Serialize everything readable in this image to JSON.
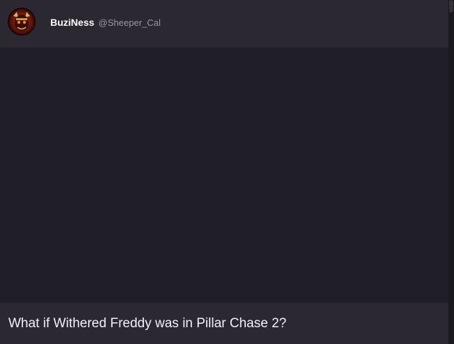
{
  "post": {
    "author": {
      "display_name": "BuziNess",
      "handle": "@Sheeper_Cal",
      "avatar_icon": "demon-avatar-icon"
    },
    "title": "What if Withered Freddy was in Pillar Chase 2?"
  },
  "colors": {
    "background": "#1f1d25",
    "header_bg": "#2b2832",
    "media_bg": "#201e26",
    "text_primary": "#ffffff",
    "text_muted": "#9a97a3"
  }
}
